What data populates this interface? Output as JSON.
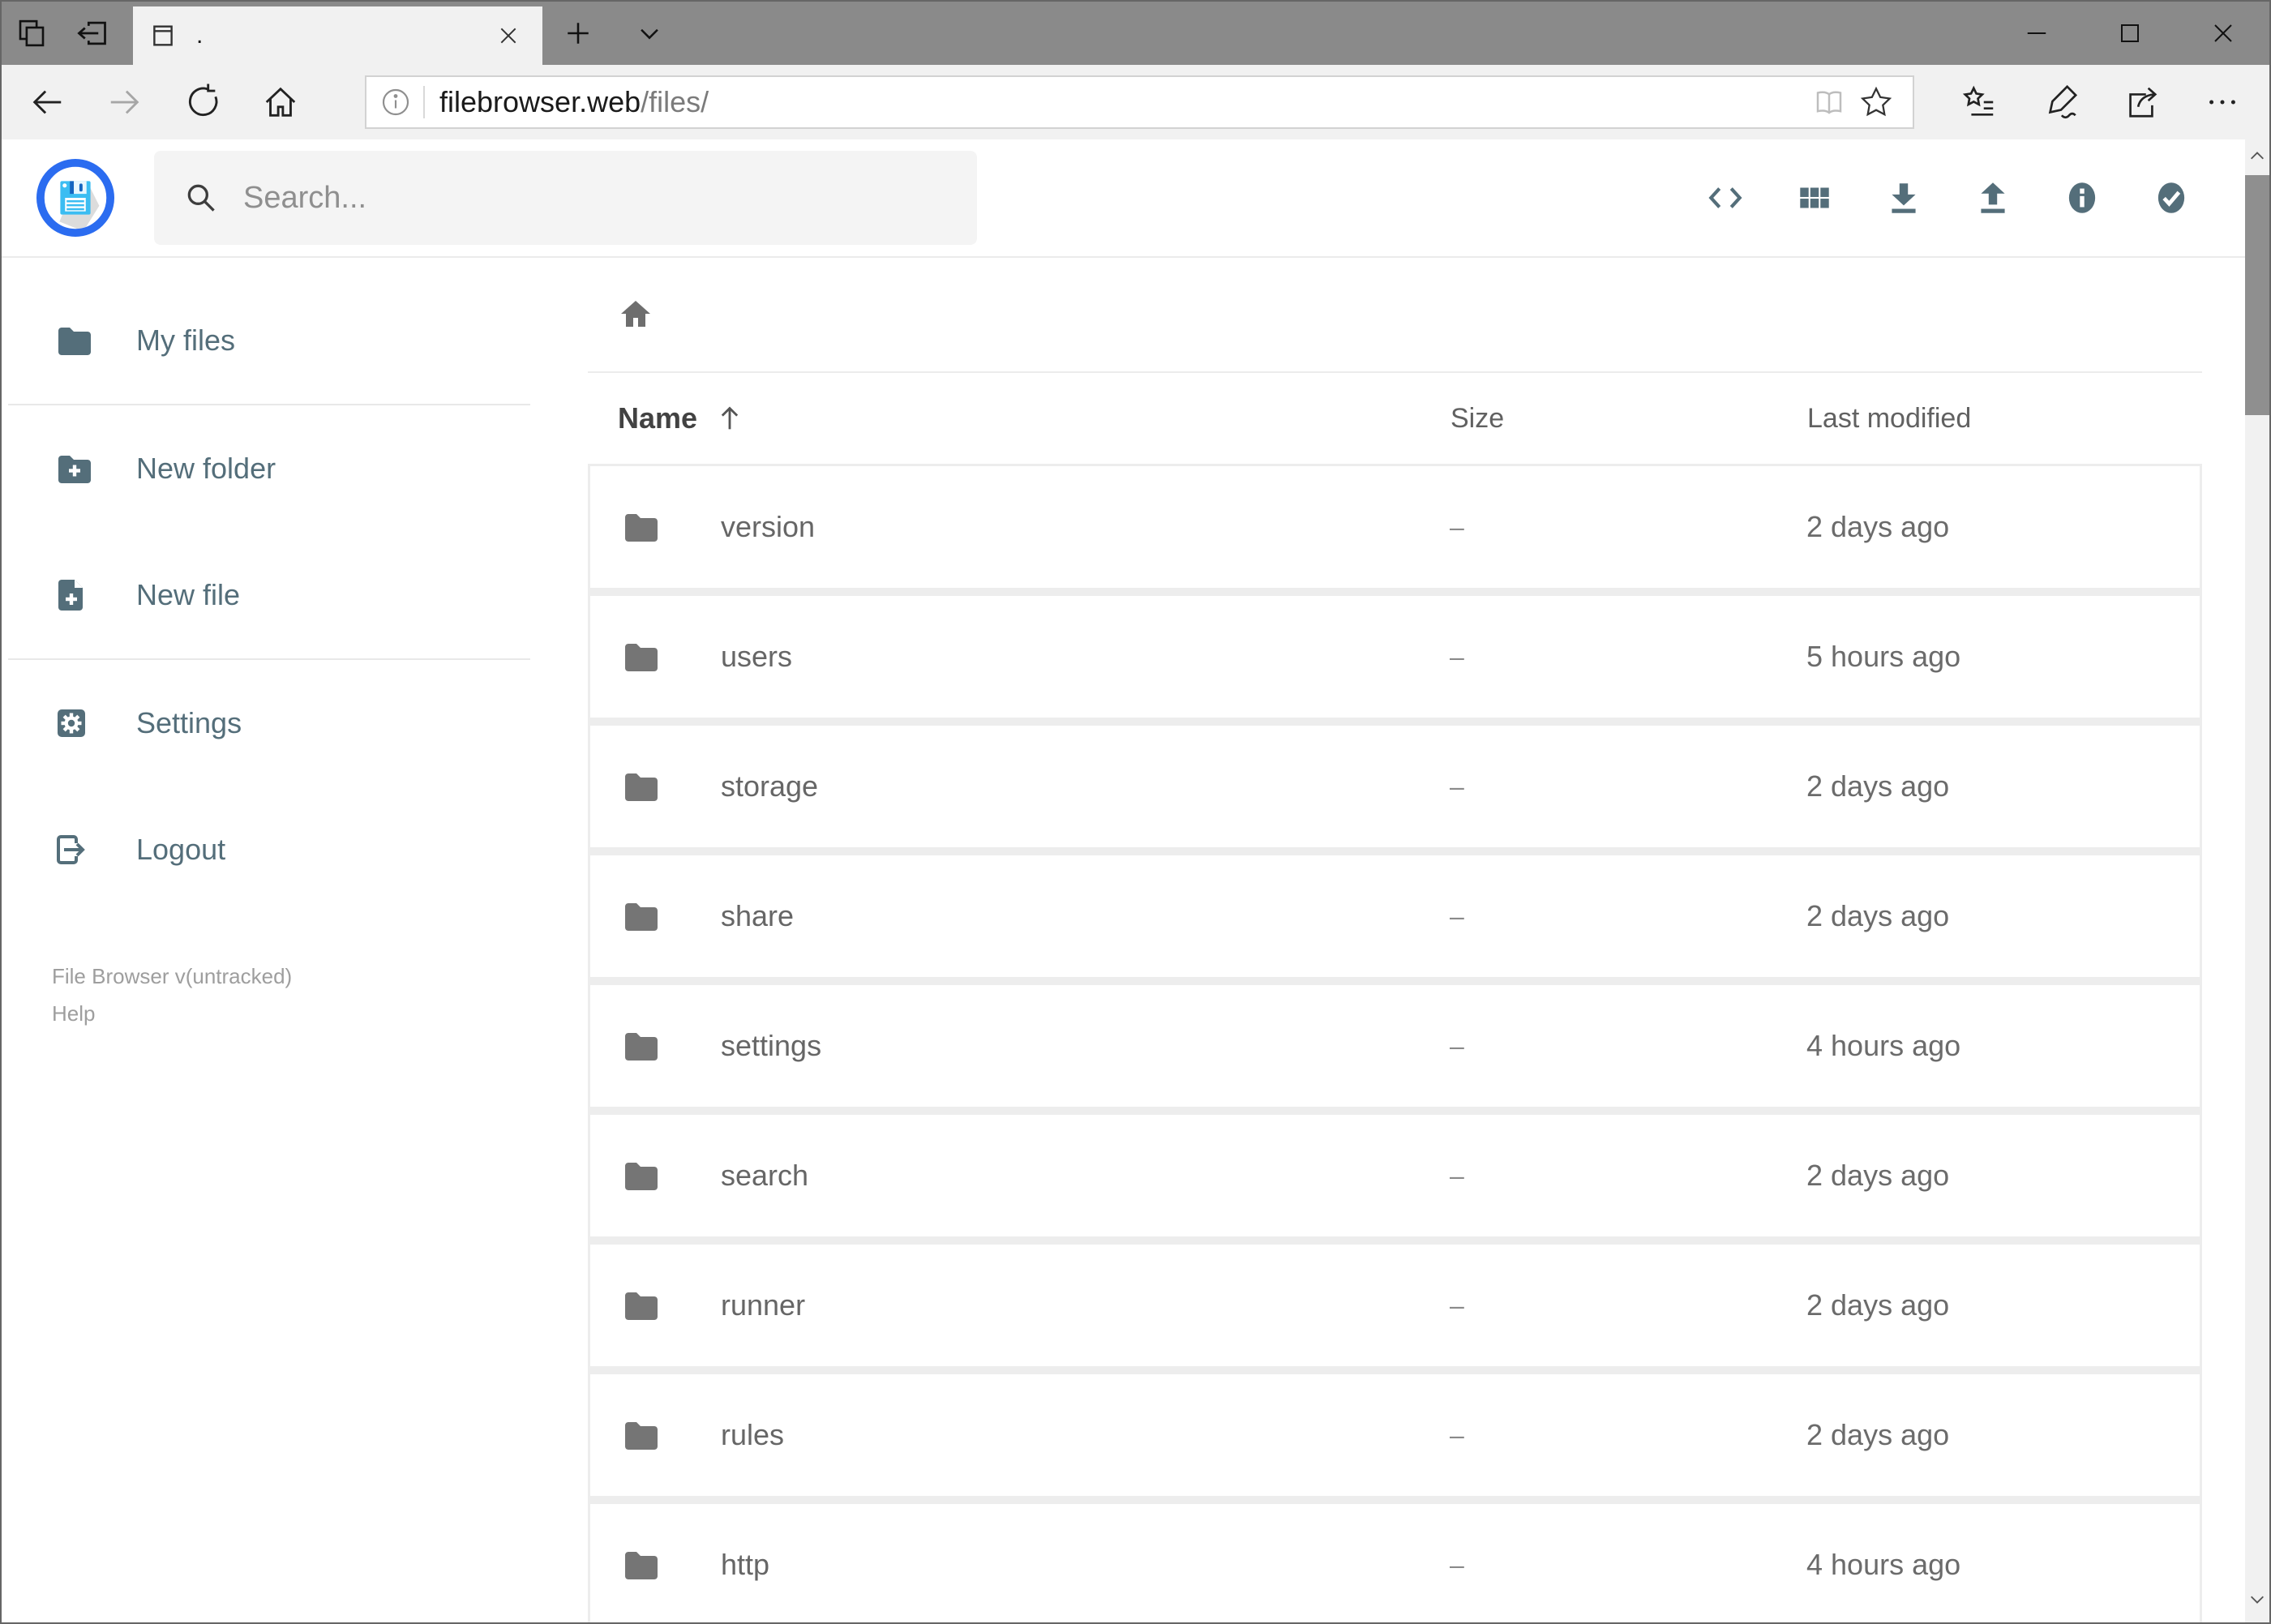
{
  "browser": {
    "tab_title": ".",
    "url_host": "filebrowser.web",
    "url_path": "/files/"
  },
  "header": {
    "search_placeholder": "Search..."
  },
  "toolbar_actions": [
    {
      "icon": "code-icon"
    },
    {
      "icon": "grid-view-icon"
    },
    {
      "icon": "download-icon"
    },
    {
      "icon": "upload-icon"
    },
    {
      "icon": "info-icon"
    },
    {
      "icon": "select-all-icon"
    }
  ],
  "sidebar": {
    "items": [
      {
        "label": "My files",
        "icon": "folder-icon"
      },
      {
        "label": "New folder",
        "icon": "new-folder-icon"
      },
      {
        "label": "New file",
        "icon": "new-file-icon"
      },
      {
        "label": "Settings",
        "icon": "settings-icon"
      },
      {
        "label": "Logout",
        "icon": "logout-icon"
      }
    ],
    "footer_version": "File Browser v(untracked)",
    "footer_help": "Help"
  },
  "listing": {
    "columns": {
      "name": "Name",
      "size": "Size",
      "modified": "Last modified"
    },
    "sort": {
      "column": "Name",
      "direction": "asc"
    },
    "rows": [
      {
        "name": "version",
        "size": "–",
        "modified": "2 days ago"
      },
      {
        "name": "users",
        "size": "–",
        "modified": "5 hours ago"
      },
      {
        "name": "storage",
        "size": "–",
        "modified": "2 days ago"
      },
      {
        "name": "share",
        "size": "–",
        "modified": "2 days ago"
      },
      {
        "name": "settings",
        "size": "–",
        "modified": "4 hours ago"
      },
      {
        "name": "search",
        "size": "–",
        "modified": "2 days ago"
      },
      {
        "name": "runner",
        "size": "–",
        "modified": "2 days ago"
      },
      {
        "name": "rules",
        "size": "–",
        "modified": "2 days ago"
      },
      {
        "name": "http",
        "size": "–",
        "modified": "4 hours ago"
      }
    ]
  },
  "colors": {
    "accent_blue": "#2b6cf0",
    "floppy_cyan": "#3bbdf2",
    "slate_icon": "#546e7a",
    "titlebar_gray": "#8a8a8a",
    "chrome_light": "#f1f1f1"
  }
}
